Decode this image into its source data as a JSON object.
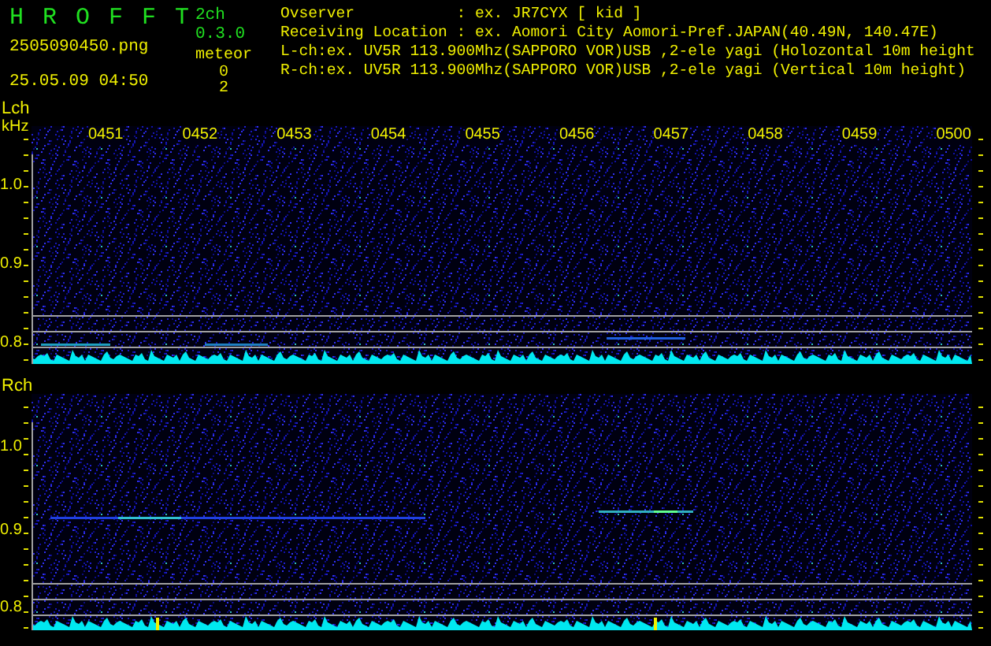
{
  "app": {
    "logo": "H R O F F T",
    "version": "2ch 0.3.0"
  },
  "file_name": "2505090450.png",
  "datetime": "25.05.09 04:50",
  "meteor": {
    "label": "meteor",
    "counts": [
      "0",
      "2"
    ]
  },
  "info_lines": [
    "Ovserver           : ex. JR7CYX [ kid ]",
    "Receiving Location : ex. Aomori City Aomori-Pref.JAPAN(40.49N, 140.47E)",
    "L-ch:ex. UV5R 113.900Mhz(SAPPORO VOR)USB ,2-ele yagi (Holozontal 10m height",
    "R-ch:ex. UV5R 113.900Mhz(SAPPORO VOR)USB ,2-ele yagi (Vertical 10m height)"
  ],
  "channels": [
    {
      "label": "Lch",
      "unit": "kHz",
      "time_labels": [
        "0451",
        "0452",
        "0453",
        "0454",
        "0455",
        "0456",
        "0457",
        "0458",
        "0459",
        "0500"
      ],
      "freq_labels": [
        "1.0",
        "0.9",
        "0.8"
      ]
    },
    {
      "label": "Rch",
      "freq_labels": [
        "1.0",
        "0.9",
        "0.8"
      ]
    }
  ]
}
